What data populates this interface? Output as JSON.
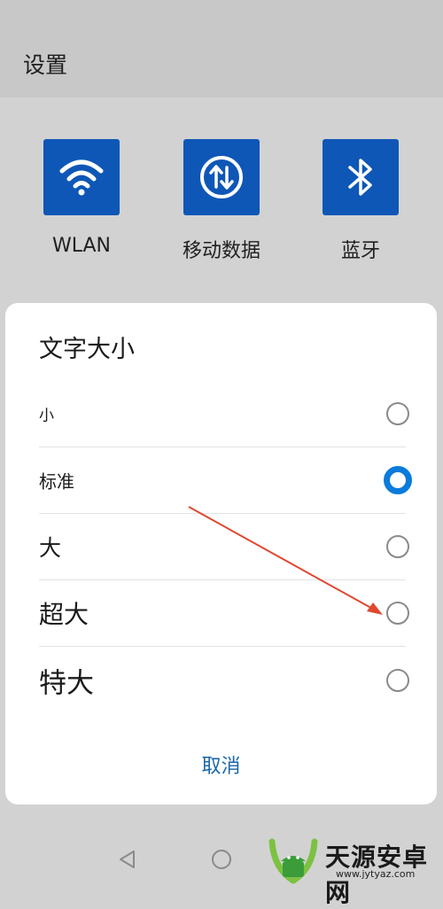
{
  "header": {
    "title": "设置"
  },
  "tiles": [
    {
      "label": "WLAN",
      "icon": "wifi-icon"
    },
    {
      "label": "移动数据",
      "icon": "mobile-data-icon"
    },
    {
      "label": "蓝牙",
      "icon": "bluetooth-icon"
    }
  ],
  "dialog": {
    "title": "文字大小",
    "options": [
      {
        "label": "小",
        "selected": false
      },
      {
        "label": "标准",
        "selected": true
      },
      {
        "label": "大",
        "selected": false
      },
      {
        "label": "超大",
        "selected": false
      },
      {
        "label": "特大",
        "selected": false
      }
    ],
    "cancel_label": "取消"
  },
  "navbar": {
    "icons": [
      "back-icon",
      "home-icon"
    ]
  },
  "watermark": {
    "text": "天源安卓网",
    "url": "www.jytyaz.com"
  },
  "colors": {
    "tile_blue": "#0e57b6",
    "radio_selected": "#0a7bdb",
    "cancel_text": "#1a67a8",
    "annotation_arrow": "#e0472f"
  }
}
